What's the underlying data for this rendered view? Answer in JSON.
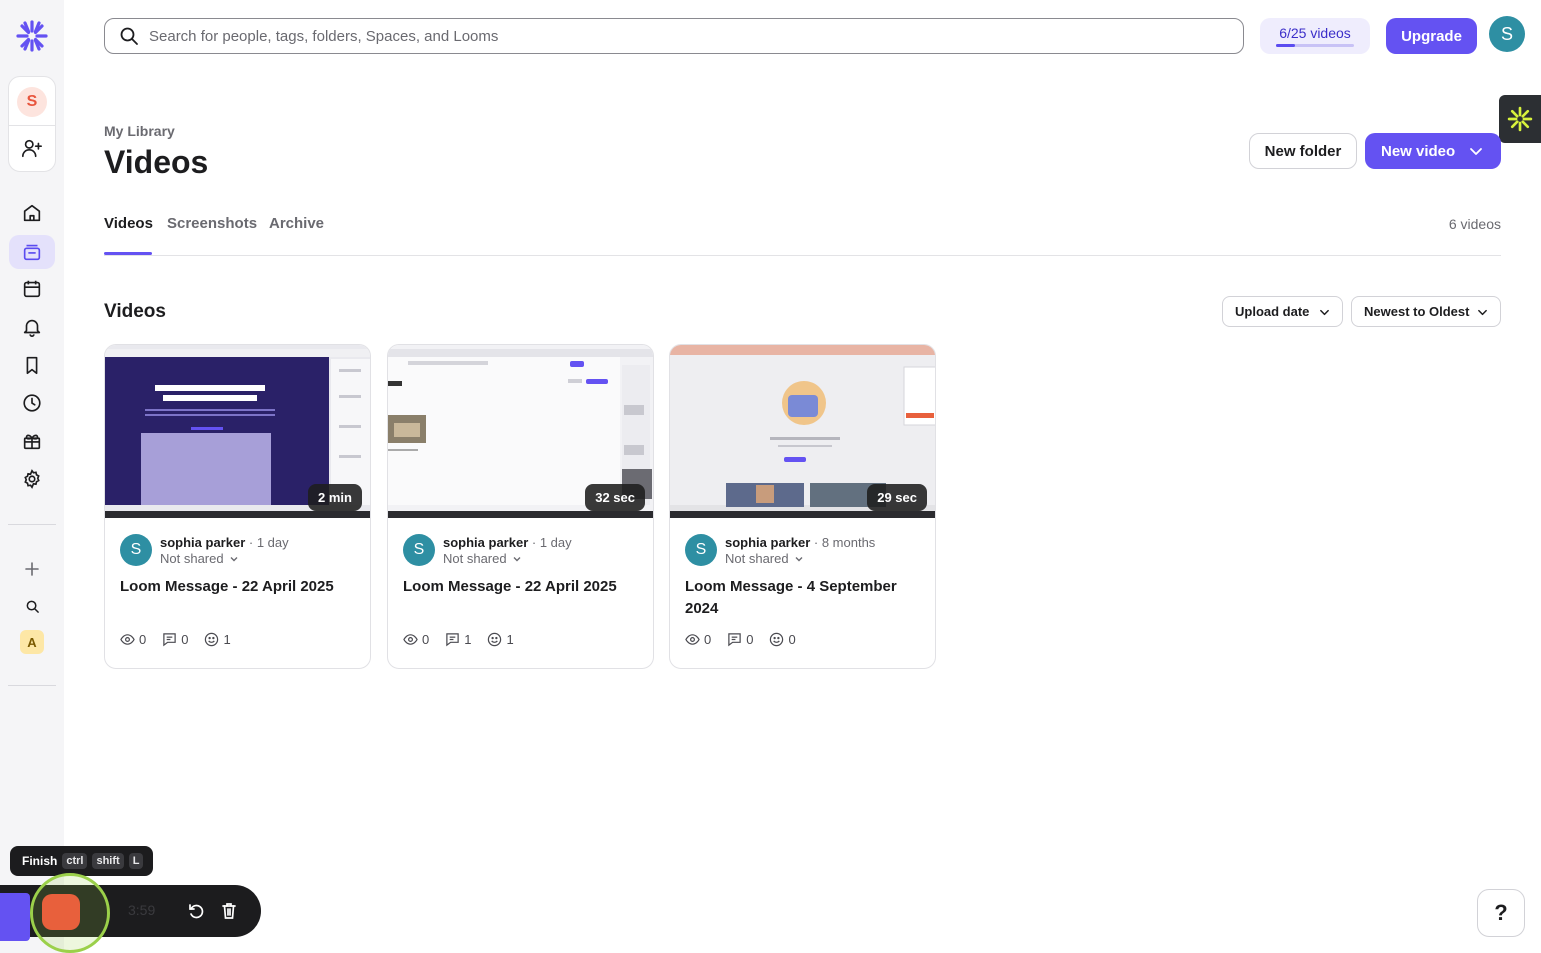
{
  "search": {
    "placeholder": "Search for people, tags, folders, Spaces, and Looms"
  },
  "header": {
    "videos_quota": "6/25 videos",
    "videos_quota_fraction": 0.24,
    "upgrade_label": "Upgrade",
    "user_initial": "S"
  },
  "sidebar": {
    "workspace_initial": "S",
    "badge_letter": "A",
    "items": [
      {
        "name": "home",
        "icon": "home-icon"
      },
      {
        "name": "library",
        "icon": "library-icon",
        "active": true
      },
      {
        "name": "meetings",
        "icon": "calendar-icon"
      },
      {
        "name": "notifications",
        "icon": "bell-icon"
      },
      {
        "name": "bookmarks",
        "icon": "bookmark-icon"
      },
      {
        "name": "history",
        "icon": "clock-icon"
      },
      {
        "name": "gifts",
        "icon": "gift-icon"
      },
      {
        "name": "settings",
        "icon": "gear-icon"
      }
    ]
  },
  "page": {
    "breadcrumb": "My Library",
    "title": "Videos",
    "new_folder_label": "New folder",
    "new_video_label": "New video",
    "tabs": [
      "Videos",
      "Screenshots",
      "Archive"
    ],
    "count_label": "6 videos",
    "section_title": "Videos",
    "sort_field": "Upload date",
    "sort_order": "Newest to Oldest"
  },
  "cards": [
    {
      "duration": "2 min",
      "owner": "sophia parker",
      "age": "· 1 day",
      "sharing": "Not shared",
      "title": "Loom Message - 22 April 2025",
      "views": "0",
      "comments": "0",
      "reactions": "1"
    },
    {
      "duration": "32 sec",
      "owner": "sophia parker",
      "age": "· 1 day",
      "sharing": "Not shared",
      "title": "Loom Message - 22 April 2025",
      "views": "0",
      "comments": "1",
      "reactions": "1"
    },
    {
      "duration": "29 sec",
      "owner": "sophia parker",
      "age": "· 8 months",
      "sharing": "Not shared",
      "title": "Loom Message - 4 September 2024",
      "views": "0",
      "comments": "0",
      "reactions": "0"
    }
  ],
  "recorder": {
    "finish_label": "Finish",
    "shortcut": [
      "ctrl",
      "shift",
      "L"
    ],
    "time": "3:59"
  },
  "help_label": "?",
  "colors": {
    "accent": "#6452f2",
    "avatar": "#2e8fa3",
    "record": "#e8603c"
  }
}
